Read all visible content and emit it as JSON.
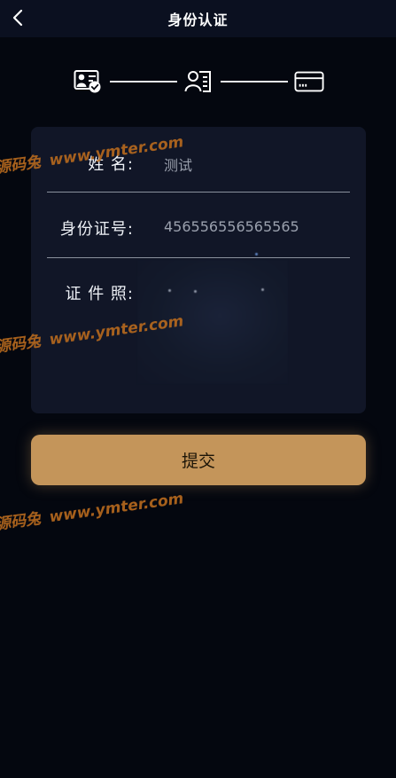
{
  "header": {
    "title": "身份认证"
  },
  "steps": [
    "id-card-check-icon",
    "person-list-icon",
    "bank-card-icon"
  ],
  "form": {
    "name_label": "姓 名:",
    "name_value": "测试",
    "id_label": "身份证号:",
    "id_value": "456556556565565",
    "photo_label": "证 件 照:"
  },
  "submit_label": "提交",
  "watermark": {
    "cn": "源码兔",
    "url": "www.ymter.com"
  },
  "colors": {
    "accent": "#c4955a",
    "background": "#04070f",
    "card": "#111627",
    "header": "#0b1020"
  }
}
